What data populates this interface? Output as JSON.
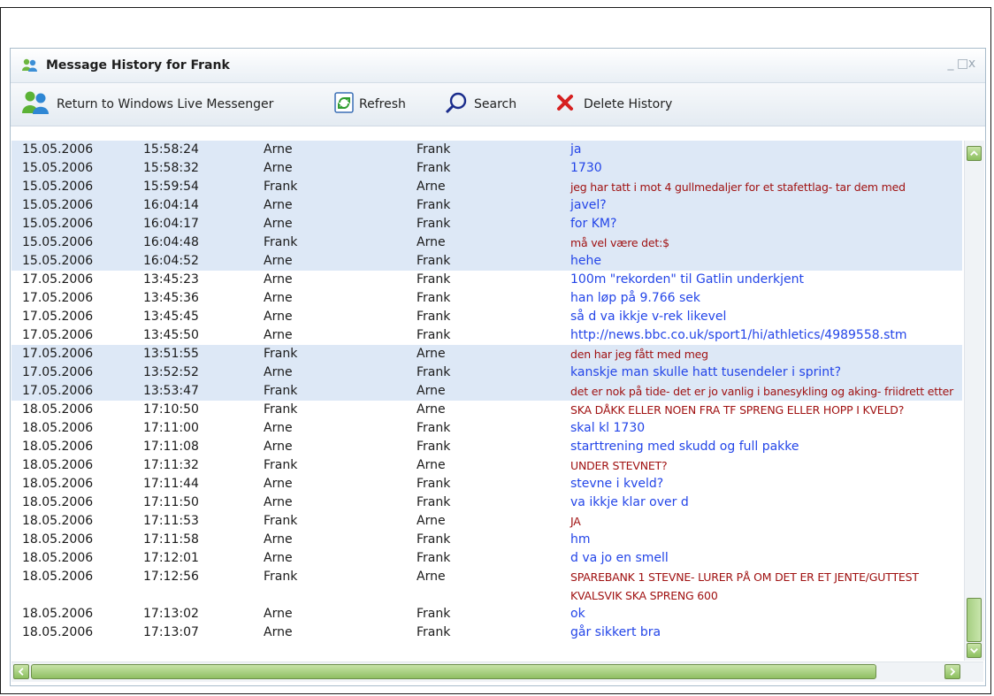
{
  "window": {
    "title": "Message History for Frank",
    "controls": [
      "_",
      "□",
      "x"
    ]
  },
  "toolbar": {
    "return_label": "Return to Windows Live Messenger",
    "refresh_label": "Refresh",
    "search_label": "Search",
    "delete_label": "Delete History"
  },
  "icons": {
    "title": "messenger-buddies-icon",
    "return": "messenger-buddies-icon",
    "refresh": "refresh-icon",
    "search": "magnifier-icon",
    "delete": "red-x-icon"
  },
  "colors": {
    "shade_row": "#dde8f6",
    "arne_msg": "#2345e8",
    "frank_msg": "#a01212",
    "scroll_green": "#8bbf5e"
  },
  "messages": [
    {
      "date": "15.05.2006",
      "time": "15:58:24",
      "from": "Arne",
      "to": "Frank",
      "text": "ja",
      "shade": true
    },
    {
      "date": "15.05.2006",
      "time": "15:58:32",
      "from": "Arne",
      "to": "Frank",
      "text": "1730",
      "shade": true
    },
    {
      "date": "15.05.2006",
      "time": "15:59:54",
      "from": "Frank",
      "to": "Arne",
      "text": "jeg har tatt i mot 4 gullmedaljer for et stafettlag- tar dem med",
      "shade": true
    },
    {
      "date": "15.05.2006",
      "time": "16:04:14",
      "from": "Arne",
      "to": "Frank",
      "text": "javel?",
      "shade": true
    },
    {
      "date": "15.05.2006",
      "time": "16:04:17",
      "from": "Arne",
      "to": "Frank",
      "text": "for KM?",
      "shade": true
    },
    {
      "date": "15.05.2006",
      "time": "16:04:48",
      "from": "Frank",
      "to": "Arne",
      "text": "må vel være det:$",
      "shade": true
    },
    {
      "date": "15.05.2006",
      "time": "16:04:52",
      "from": "Arne",
      "to": "Frank",
      "text": "hehe",
      "shade": true
    },
    {
      "date": "17.05.2006",
      "time": "13:45:23",
      "from": "Arne",
      "to": "Frank",
      "text": "100m \"rekorden\" til Gatlin underkjent",
      "shade": false
    },
    {
      "date": "17.05.2006",
      "time": "13:45:36",
      "from": "Arne",
      "to": "Frank",
      "text": "han løp på 9.766 sek",
      "shade": false
    },
    {
      "date": "17.05.2006",
      "time": "13:45:45",
      "from": "Arne",
      "to": "Frank",
      "text": "så d va ikkje v-rek likevel",
      "shade": false
    },
    {
      "date": "17.05.2006",
      "time": "13:45:50",
      "from": "Arne",
      "to": "Frank",
      "text": "http://news.bbc.co.uk/sport1/hi/athletics/4989558.stm",
      "shade": false
    },
    {
      "date": "17.05.2006",
      "time": "13:51:55",
      "from": "Frank",
      "to": "Arne",
      "text": "den har jeg fått med meg",
      "shade": true
    },
    {
      "date": "17.05.2006",
      "time": "13:52:52",
      "from": "Arne",
      "to": "Frank",
      "text": "kanskje man skulle hatt tusendeler i sprint?",
      "shade": true
    },
    {
      "date": "17.05.2006",
      "time": "13:53:47",
      "from": "Frank",
      "to": "Arne",
      "text": "det er nok på tide- det er jo vanlig i banesykling og aking- friidrett etter",
      "shade": true,
      "two": true
    },
    {
      "date": "18.05.2006",
      "time": "17:10:50",
      "from": "Frank",
      "to": "Arne",
      "text": "SKA DÅKK ELLER NOEN FRA TF SPRENG ELLER HOPP I KVELD?",
      "shade": false
    },
    {
      "date": "18.05.2006",
      "time": "17:11:00",
      "from": "Arne",
      "to": "Frank",
      "text": "skal kl 1730",
      "shade": false
    },
    {
      "date": "18.05.2006",
      "time": "17:11:08",
      "from": "Arne",
      "to": "Frank",
      "text": "starttrening med skudd og full pakke",
      "shade": false
    },
    {
      "date": "18.05.2006",
      "time": "17:11:32",
      "from": "Frank",
      "to": "Arne",
      "text": "UNDER STEVNET?",
      "shade": false
    },
    {
      "date": "18.05.2006",
      "time": "17:11:44",
      "from": "Arne",
      "to": "Frank",
      "text": "stevne i kveld?",
      "shade": false
    },
    {
      "date": "18.05.2006",
      "time": "17:11:50",
      "from": "Arne",
      "to": "Frank",
      "text": "va ikkje klar over d",
      "shade": false
    },
    {
      "date": "18.05.2006",
      "time": "17:11:53",
      "from": "Frank",
      "to": "Arne",
      "text": "JA",
      "shade": false
    },
    {
      "date": "18.05.2006",
      "time": "17:11:58",
      "from": "Arne",
      "to": "Frank",
      "text": "hm",
      "shade": false
    },
    {
      "date": "18.05.2006",
      "time": "17:12:01",
      "from": "Arne",
      "to": "Frank",
      "text": "d va jo en smell",
      "shade": false
    },
    {
      "date": "18.05.2006",
      "time": "17:12:56",
      "from": "Frank",
      "to": "Arne",
      "text": "SPAREBANK 1 STEVNE- LURER PÅ OM DET ER ET JENTE/GUTTEST KVALSVIK SKA SPRENG 600",
      "shade": false,
      "two": true
    },
    {
      "date": "18.05.2006",
      "time": "17:13:02",
      "from": "Arne",
      "to": "Frank",
      "text": "ok",
      "shade": false
    },
    {
      "date": "18.05.2006",
      "time": "17:13:07",
      "from": "Arne",
      "to": "Frank",
      "text": "går sikkert bra",
      "shade": false
    }
  ]
}
